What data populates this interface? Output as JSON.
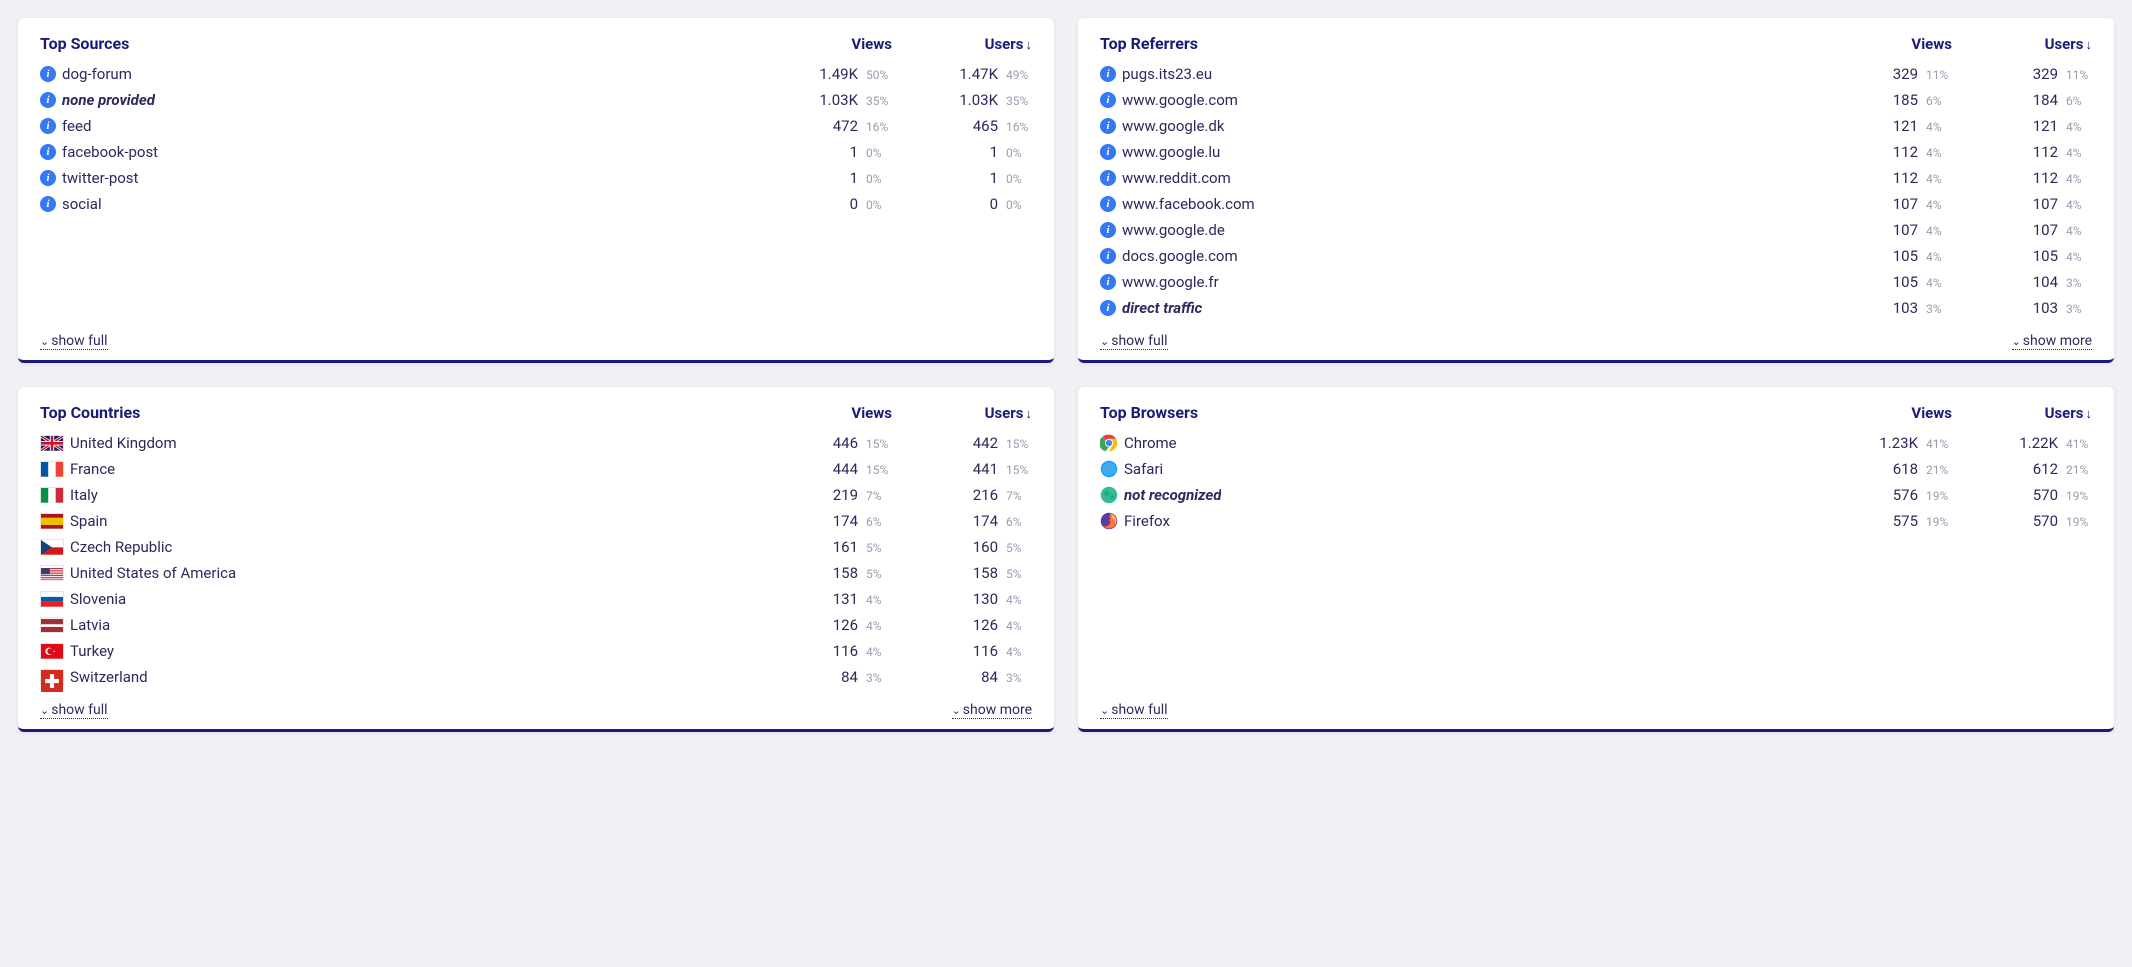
{
  "labels": {
    "views": "Views",
    "users": "Users",
    "show_full": "show full",
    "show_more": "show more"
  },
  "cards": [
    {
      "id": "top-sources",
      "title": "Top Sources",
      "icon_type": "info",
      "show_full": true,
      "show_more": false,
      "min_rows": 10,
      "rows": [
        {
          "label": "dog-forum",
          "views": "1.49K",
          "views_pct": "50%",
          "users": "1.47K",
          "users_pct": "49%"
        },
        {
          "label": "none provided",
          "italic": true,
          "views": "1.03K",
          "views_pct": "35%",
          "users": "1.03K",
          "users_pct": "35%"
        },
        {
          "label": "feed",
          "views": "472",
          "views_pct": "16%",
          "users": "465",
          "users_pct": "16%"
        },
        {
          "label": "facebook-post",
          "views": "1",
          "views_pct": "0%",
          "users": "1",
          "users_pct": "0%"
        },
        {
          "label": "twitter-post",
          "views": "1",
          "views_pct": "0%",
          "users": "1",
          "users_pct": "0%"
        },
        {
          "label": "social",
          "views": "0",
          "views_pct": "0%",
          "users": "0",
          "users_pct": "0%"
        }
      ]
    },
    {
      "id": "top-referrers",
      "title": "Top Referrers",
      "icon_type": "info",
      "show_full": true,
      "show_more": true,
      "rows": [
        {
          "label": "pugs.its23.eu",
          "views": "329",
          "views_pct": "11%",
          "users": "329",
          "users_pct": "11%"
        },
        {
          "label": "www.google.com",
          "views": "185",
          "views_pct": "6%",
          "users": "184",
          "users_pct": "6%"
        },
        {
          "label": "www.google.dk",
          "views": "121",
          "views_pct": "4%",
          "users": "121",
          "users_pct": "4%"
        },
        {
          "label": "www.google.lu",
          "views": "112",
          "views_pct": "4%",
          "users": "112",
          "users_pct": "4%"
        },
        {
          "label": "www.reddit.com",
          "views": "112",
          "views_pct": "4%",
          "users": "112",
          "users_pct": "4%"
        },
        {
          "label": "www.facebook.com",
          "views": "107",
          "views_pct": "4%",
          "users": "107",
          "users_pct": "4%"
        },
        {
          "label": "www.google.de",
          "views": "107",
          "views_pct": "4%",
          "users": "107",
          "users_pct": "4%"
        },
        {
          "label": "docs.google.com",
          "views": "105",
          "views_pct": "4%",
          "users": "105",
          "users_pct": "4%"
        },
        {
          "label": "www.google.fr",
          "views": "105",
          "views_pct": "4%",
          "users": "104",
          "users_pct": "3%"
        },
        {
          "label": "direct traffic",
          "italic": true,
          "views": "103",
          "views_pct": "3%",
          "users": "103",
          "users_pct": "3%"
        }
      ]
    },
    {
      "id": "top-countries",
      "title": "Top Countries",
      "icon_type": "flag",
      "show_full": true,
      "show_more": true,
      "rows": [
        {
          "label": "United Kingdom",
          "flag": "gb",
          "views": "446",
          "views_pct": "15%",
          "users": "442",
          "users_pct": "15%"
        },
        {
          "label": "France",
          "flag": "fr",
          "views": "444",
          "views_pct": "15%",
          "users": "441",
          "users_pct": "15%"
        },
        {
          "label": "Italy",
          "flag": "it",
          "views": "219",
          "views_pct": "7%",
          "users": "216",
          "users_pct": "7%"
        },
        {
          "label": "Spain",
          "flag": "es",
          "views": "174",
          "views_pct": "6%",
          "users": "174",
          "users_pct": "6%"
        },
        {
          "label": "Czech Republic",
          "flag": "cz",
          "views": "161",
          "views_pct": "5%",
          "users": "160",
          "users_pct": "5%"
        },
        {
          "label": "United States of America",
          "flag": "us",
          "views": "158",
          "views_pct": "5%",
          "users": "158",
          "users_pct": "5%"
        },
        {
          "label": "Slovenia",
          "flag": "si",
          "views": "131",
          "views_pct": "4%",
          "users": "130",
          "users_pct": "4%"
        },
        {
          "label": "Latvia",
          "flag": "lv",
          "views": "126",
          "views_pct": "4%",
          "users": "126",
          "users_pct": "4%"
        },
        {
          "label": "Turkey",
          "flag": "tr",
          "views": "116",
          "views_pct": "4%",
          "users": "116",
          "users_pct": "4%"
        },
        {
          "label": "Switzerland",
          "flag": "ch",
          "views": "84",
          "views_pct": "3%",
          "users": "84",
          "users_pct": "3%"
        }
      ]
    },
    {
      "id": "top-browsers",
      "title": "Top Browsers",
      "icon_type": "browser",
      "show_full": true,
      "show_more": false,
      "min_rows": 10,
      "rows": [
        {
          "label": "Chrome",
          "browser": "chrome",
          "views": "1.23K",
          "views_pct": "41%",
          "users": "1.22K",
          "users_pct": "41%"
        },
        {
          "label": "Safari",
          "browser": "safari",
          "views": "618",
          "views_pct": "21%",
          "users": "612",
          "users_pct": "21%"
        },
        {
          "label": "not recognized",
          "italic": true,
          "browser": "globe",
          "views": "576",
          "views_pct": "19%",
          "users": "570",
          "users_pct": "19%"
        },
        {
          "label": "Firefox",
          "browser": "firefox",
          "views": "575",
          "views_pct": "19%",
          "users": "570",
          "users_pct": "19%"
        }
      ]
    }
  ]
}
